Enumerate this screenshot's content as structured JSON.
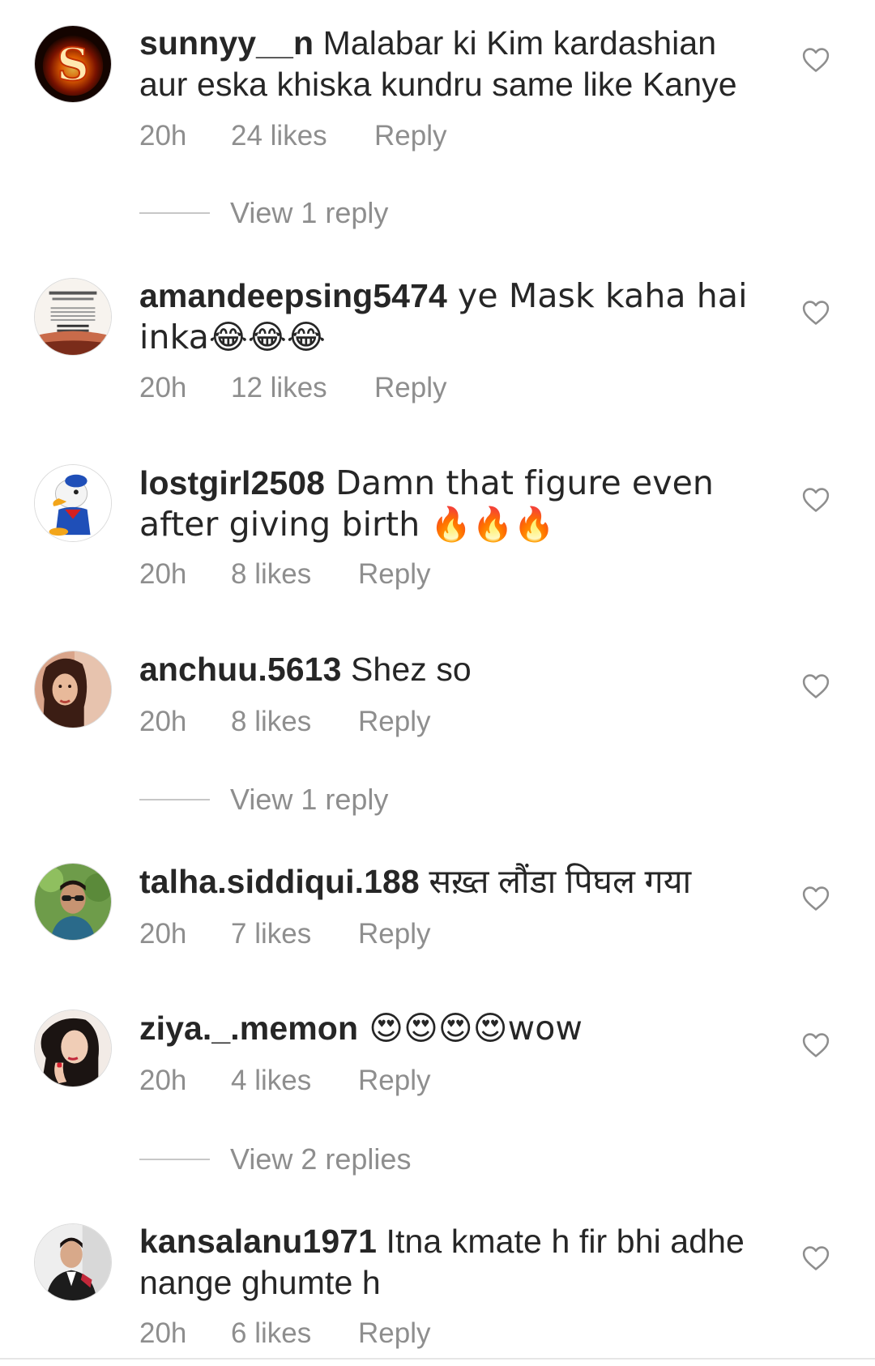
{
  "comments": [
    {
      "username": "sunnyy__n",
      "text": " Malabar ki Kim kardashian aur eska khiska kundru same like Kanye",
      "time": "20h",
      "likes": "24 likes",
      "reply_label": "Reply",
      "view_replies": "View 1 reply",
      "avatar_icon": "letter-s-fire-avatar"
    },
    {
      "username": "amandeepsing5474",
      "text": " ye Mask kaha hai inka😂😂😂",
      "time": "20h",
      "likes": "12 likes",
      "reply_label": "Reply",
      "avatar_icon": "text-poster-avatar"
    },
    {
      "username": "lostgirl2508",
      "text": " Damn that figure even after giving birth 🔥🔥🔥",
      "time": "20h",
      "likes": "8 likes",
      "reply_label": "Reply",
      "avatar_icon": "cartoon-duck-avatar"
    },
    {
      "username": "anchuu.5613",
      "text": " Shez so",
      "time": "20h",
      "likes": "8 likes",
      "reply_label": "Reply",
      "view_replies": "View 1 reply",
      "avatar_icon": "person-photo-avatar"
    },
    {
      "username": "talha.siddiqui.188",
      "text": " सख़्त लौंडा पिघल गया",
      "time": "20h",
      "likes": "7 likes",
      "reply_label": "Reply",
      "avatar_icon": "person-photo-avatar"
    },
    {
      "username": "ziya._.memon",
      "text": " 😍😍😍😍wow",
      "time": "20h",
      "likes": "4 likes",
      "reply_label": "Reply",
      "view_replies": "View 2 replies",
      "avatar_icon": "person-photo-avatar"
    },
    {
      "username": "kansalanu1971",
      "text": " Itna kmate h fir bhi adhe nange ghumte h",
      "time": "20h",
      "likes": "6 likes",
      "reply_label": "Reply",
      "avatar_icon": "person-photo-avatar"
    }
  ],
  "icons": {
    "like": "heart-outline-icon"
  },
  "colors": {
    "text_primary": "#262626",
    "text_secondary": "#8e8e8e",
    "divider": "#c7c7c7"
  }
}
